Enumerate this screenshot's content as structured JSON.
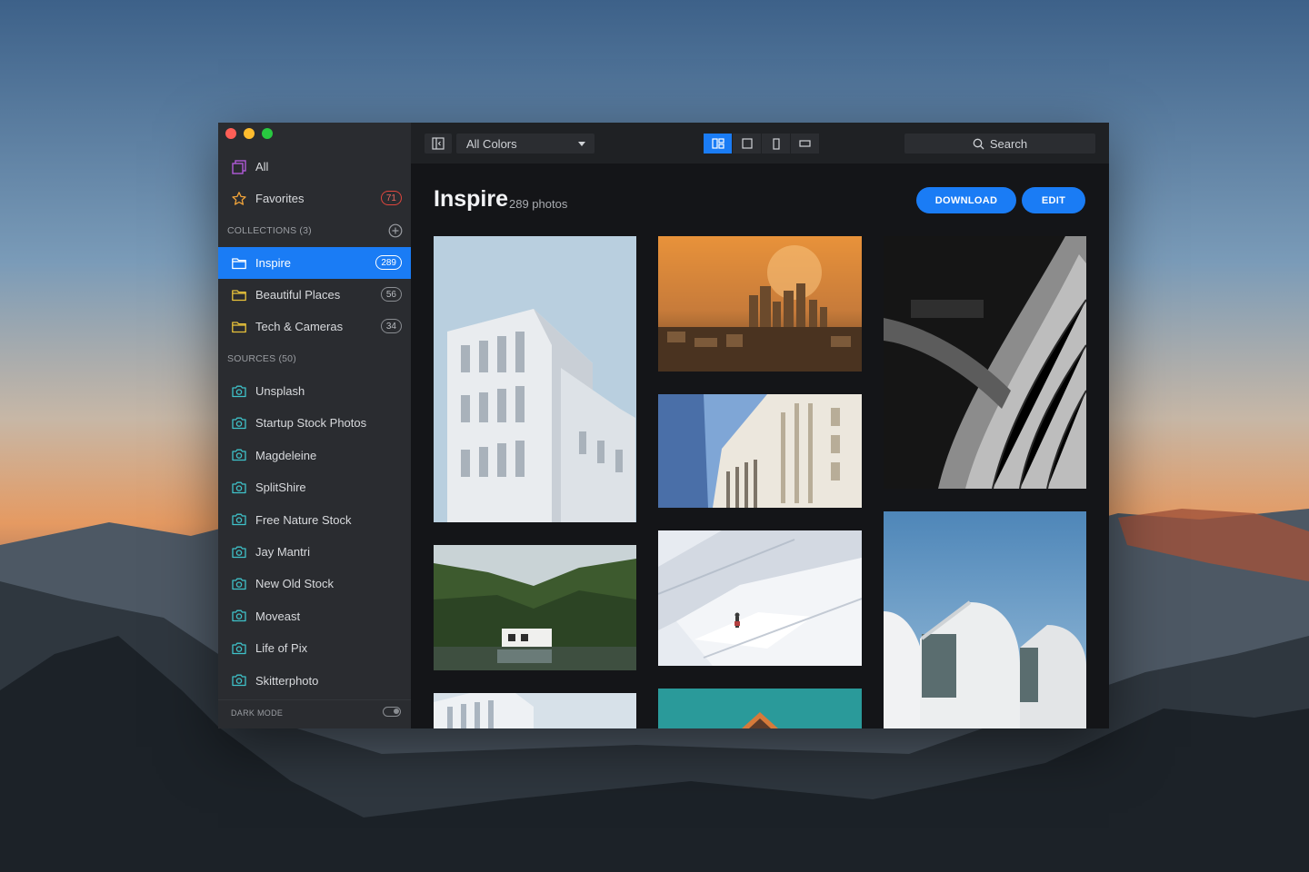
{
  "sidebar": {
    "all_label": "All",
    "favorites_label": "Favorites",
    "favorites_count": "71",
    "collections_heading": "COLLECTIONS (3)",
    "collections": [
      {
        "label": "Inspire",
        "count": "289"
      },
      {
        "label": "Beautiful Places",
        "count": "56"
      },
      {
        "label": "Tech & Cameras",
        "count": "34"
      }
    ],
    "sources_heading": "SOURCES (50)",
    "sources": [
      "Unsplash",
      "Startup Stock Photos",
      "Magdeleine",
      "SplitShire",
      "Free Nature Stock",
      "Jay Mantri",
      "New Old Stock",
      "Moveast",
      "Life of Pix",
      "Skitterphoto"
    ],
    "dark_mode_label": "DARK MODE"
  },
  "toolbar": {
    "color_filter": "All Colors",
    "search_placeholder": "Search"
  },
  "main": {
    "title": "Inspire",
    "subtitle": "289 photos",
    "download_label": "DOWNLOAD",
    "edit_label": "EDIT"
  },
  "colors": {
    "accent": "#1a7cf5",
    "sidebar_bg": "#2a2c30",
    "main_bg": "#141518",
    "favorites_badge": "#e0463d",
    "folder_icon": "#e8c23a",
    "source_icon": "#3fc2c9"
  }
}
